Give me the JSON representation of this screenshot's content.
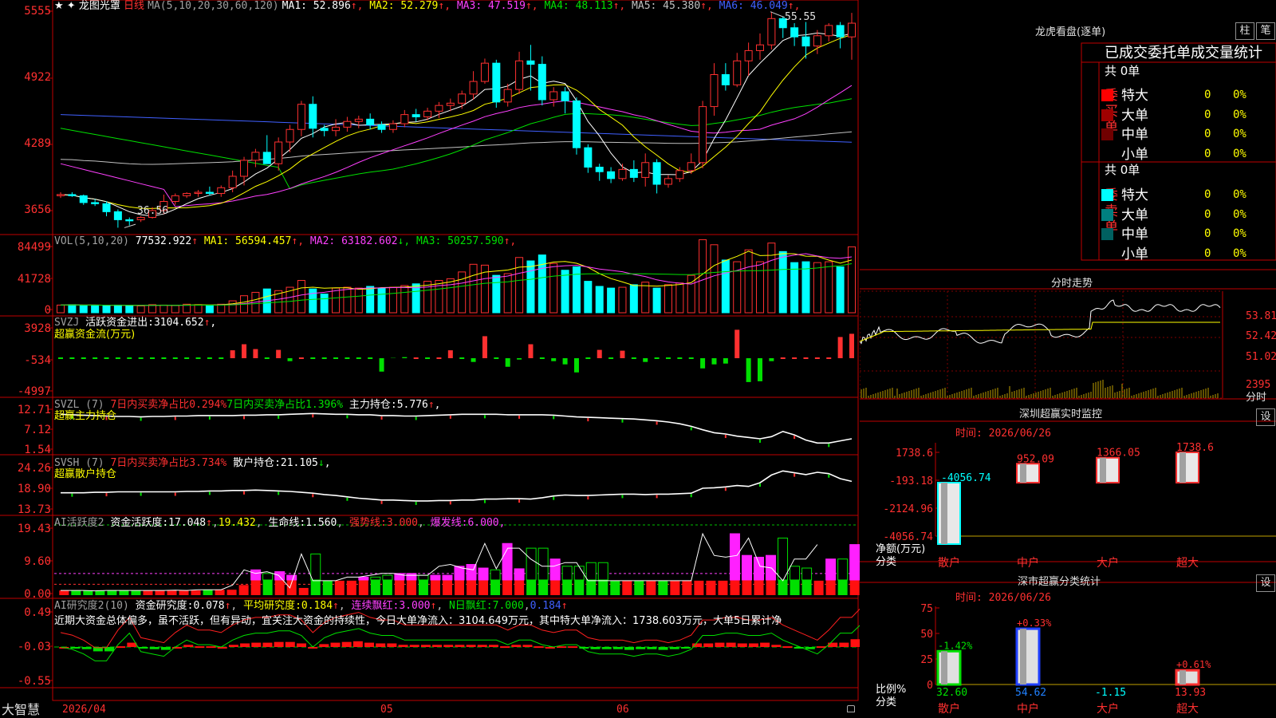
{
  "window": {
    "app_name": "大智慧",
    "date_label": "2026/04",
    "month_labels": [
      "05",
      "06"
    ],
    "star": "★",
    "diamond": "✦"
  },
  "main": {
    "stock": "龙图光罩",
    "period": "日线",
    "ma_title": "MA(5,10,20,30,60,120)",
    "ma": [
      {
        "label": "MA1:",
        "value": "52.896",
        "arrow": "↑",
        "color": "#ffffff"
      },
      {
        "label": "MA2:",
        "value": "52.279",
        "arrow": "↑",
        "color": "#ffff00"
      },
      {
        "label": "MA3:",
        "value": "47.519",
        "arrow": "↑",
        "color": "#ff40ff"
      },
      {
        "label": "MA4:",
        "value": "48.113",
        "arrow": "↑",
        "color": "#00e000"
      },
      {
        "label": "MA5:",
        "value": "45.380",
        "arrow": "↑",
        "color": "#c0c0c0"
      },
      {
        "label": "MA6:",
        "value": "46.049",
        "arrow": "↑",
        "color": "#4060ff"
      }
    ],
    "y_labels": [
      "5555",
      "4922",
      "4289",
      "3656"
    ],
    "high_label": "55.55",
    "low_label": "36.56"
  },
  "vol": {
    "title": "VOL(5,10,20)",
    "value": "77532.922",
    "arrow": "↑",
    "ma": [
      {
        "label": "MA1:",
        "value": "56594.457",
        "arrow": "↑",
        "color": "#ffff00"
      },
      {
        "label": "MA2:",
        "value": "63182.602",
        "arrow": "↓",
        "color": "#ff40ff"
      },
      {
        "label": "MA3:",
        "value": "50257.590",
        "arrow": "↑",
        "color": "#00e000"
      }
    ],
    "y_labels": [
      "84499",
      "41728",
      "0"
    ]
  },
  "svzj": {
    "title": "SVZJ",
    "label": "活跃资金进出:",
    "value": "3104.652",
    "arrow": "↑",
    "tail": ",",
    "subtitle": "超赢资金流(万元)",
    "y_labels": [
      "3928",
      "-534",
      "-4997"
    ]
  },
  "svzl": {
    "title": "SVZL (7)",
    "a": "7日内买卖净占比0.294%",
    "b": "7日内买卖净占比1.396%",
    "c_label": "主力持仓:",
    "c_value": "5.776",
    "arrow": "↑",
    "tail": ",",
    "subtitle": "超赢主力持仓",
    "y_labels": [
      "12.71",
      "7.12",
      "1.54"
    ]
  },
  "svsh": {
    "title": "SVSH (7)",
    "a": "7日内买卖净占比3.734%",
    "c_label": "散户持仓:",
    "c_value": "21.105",
    "arrow": "↓",
    "tail": ",",
    "subtitle": "超赢散户持仓",
    "y_labels": [
      "24.26",
      "18.90",
      "13.73"
    ]
  },
  "ai1": {
    "title": "AI活跃度2",
    "label": "资金活跃度:",
    "v1": "17.048",
    "a1": "↑",
    "v2": "19.432",
    "l2": "生命线:",
    "v3": "1.560",
    "l4": "强势线:",
    "v4": "3.000",
    "l5": "爆发线:",
    "v5": "6.000",
    "tail": ",",
    "y_labels": [
      "19.43",
      "9.60",
      "0.00"
    ]
  },
  "ai2": {
    "title": "AI研究度2(10)",
    "label": "资金研究度:",
    "v1": "0.078",
    "a1": "↑",
    "l2": "平均研究度:",
    "v2": "0.184",
    "a2": "↑",
    "l3": "连续飘红:",
    "v3": "3.000",
    "a3": "↑",
    "l4": "N日飘红:",
    "v4": "7.000",
    "v5": "0.184",
    "a5": "↑",
    "note": "近期大资金总体偏多，虽不活跃，但有异动，宜关注大资金的持续性，今日大单净流入：3104.649万元，其中特大单净流入：1738.603万元，大单5日累计净",
    "y_labels": [
      "0.49",
      "-0.03",
      "-0.55"
    ]
  },
  "right": {
    "lhb": {
      "title": "龙虎看盘(逐单)",
      "btn1": "柱",
      "btn2": "笔",
      "header": "已成交委托单成交量统计",
      "buy_side": "委买单",
      "sell_side": "委卖单",
      "total": "共 0单",
      "rows": [
        {
          "name": "特大",
          "count": "0",
          "pct": "0%",
          "buy_color": "#ff0000",
          "sell_color": "#00ffff"
        },
        {
          "name": "大单",
          "count": "0",
          "pct": "0%",
          "buy_color": "#a00000",
          "sell_color": "#008080"
        },
        {
          "name": "中单",
          "count": "0",
          "pct": "0%",
          "buy_color": "#700000",
          "sell_color": "#006060"
        },
        {
          "name": "小单",
          "count": "0",
          "pct": "0%",
          "buy_color": "",
          "sell_color": ""
        }
      ]
    },
    "fs": {
      "title": "分时走势",
      "y_labels": [
        "53.81",
        "52.42",
        "51.02",
        "2395"
      ],
      "unit": "分时"
    },
    "sz1": {
      "title": "深圳超赢实时监控",
      "btn": "设",
      "date": "时间: 2026/06/26",
      "y_labels": [
        "1738.6",
        "-193.18",
        "-2124.96",
        "-4056.74"
      ],
      "y_unit": "净额(万元)",
      "x_unit": "分类",
      "categories": [
        "散户",
        "中户",
        "大户",
        "超大"
      ],
      "values": [
        -4056.74,
        952.09,
        1366.05,
        1738.6
      ],
      "value_labels": [
        "-4056.74",
        "952.09",
        "1366.05",
        "1738.6"
      ]
    },
    "sz2": {
      "title": "深市超赢分类统计",
      "btn": "设",
      "date": "时间: 2026/06/26",
      "y_labels": [
        "75",
        "50",
        "25",
        "0"
      ],
      "y_unit": "比例%",
      "x_unit": "分类",
      "categories": [
        "散户",
        "中户",
        "大户",
        "超大"
      ],
      "values": [
        32.6,
        54.62,
        -1.15,
        13.93
      ],
      "deltas": [
        "-1.42%",
        "+0.33%",
        "",
        "+0.61%"
      ],
      "value_labels": [
        "32.60",
        "54.62",
        "-1.15",
        "13.93"
      ]
    }
  },
  "chart_data": [
    {
      "type": "candlestick",
      "title": "龙图光罩 日线",
      "ylim": [
        36.56,
        55.55
      ],
      "ohlc": [
        [
          39.4,
          39.7,
          39.2,
          39.5
        ],
        [
          39.5,
          39.7,
          39.3,
          39.4
        ],
        [
          39.4,
          39.5,
          38.6,
          38.8
        ],
        [
          38.8,
          39.1,
          38.5,
          38.7
        ],
        [
          38.7,
          38.9,
          37.6,
          38.0
        ],
        [
          38.0,
          38.2,
          36.6,
          37.3
        ],
        [
          37.3,
          37.5,
          36.8,
          37.2
        ],
        [
          37.3,
          37.6,
          37.1,
          37.5
        ],
        [
          37.5,
          38.4,
          37.4,
          38.1
        ],
        [
          38.1,
          39.5,
          37.8,
          38.9
        ],
        [
          38.9,
          39.6,
          38.6,
          39.4
        ],
        [
          39.4,
          39.7,
          39.2,
          39.6
        ],
        [
          39.6,
          39.9,
          39.3,
          39.7
        ],
        [
          39.7,
          40.2,
          39.4,
          39.6
        ],
        [
          39.6,
          40.3,
          39.3,
          40.1
        ],
        [
          40.1,
          41.6,
          39.7,
          41.1
        ],
        [
          41.1,
          42.8,
          40.3,
          42.5
        ],
        [
          42.5,
          43.5,
          41.9,
          43.2
        ],
        [
          43.2,
          44.7,
          42.4,
          42.2
        ],
        [
          42.2,
          44.5,
          41.6,
          44.1
        ],
        [
          44.1,
          45.6,
          43.2,
          45.2
        ],
        [
          45.2,
          47.7,
          44.6,
          47.4
        ],
        [
          47.4,
          48.1,
          44.5,
          45.3
        ],
        [
          45.3,
          45.6,
          44.6,
          45.1
        ],
        [
          45.1,
          46.1,
          44.6,
          45.4
        ],
        [
          45.4,
          46.3,
          45.0,
          45.9
        ],
        [
          45.9,
          46.4,
          45.3,
          46.1
        ],
        [
          46.1,
          46.6,
          45.2,
          45.6
        ],
        [
          45.6,
          45.9,
          44.9,
          45.2
        ],
        [
          45.2,
          46.0,
          44.9,
          45.7
        ],
        [
          45.7,
          46.9,
          45.4,
          46.5
        ],
        [
          46.5,
          47.0,
          45.9,
          46.3
        ],
        [
          46.3,
          47.1,
          46.0,
          46.8
        ],
        [
          46.8,
          47.6,
          46.2,
          47.3
        ],
        [
          47.3,
          47.9,
          46.8,
          47.5
        ],
        [
          47.5,
          48.6,
          47.0,
          48.3
        ],
        [
          48.3,
          50.3,
          47.8,
          49.4
        ],
        [
          49.4,
          51.4,
          49.2,
          51.0
        ],
        [
          51.0,
          51.3,
          47.1,
          47.6
        ],
        [
          47.6,
          49.2,
          47.2,
          48.7
        ],
        [
          48.7,
          52.0,
          48.3,
          51.2
        ],
        [
          51.2,
          52.6,
          48.6,
          50.9
        ],
        [
          50.9,
          51.6,
          47.3,
          47.8
        ],
        [
          47.8,
          48.9,
          47.2,
          48.5
        ],
        [
          48.5,
          48.9,
          46.6,
          47.7
        ],
        [
          47.7,
          48.0,
          43.0,
          43.6
        ],
        [
          43.6,
          43.9,
          41.4,
          41.9
        ],
        [
          41.9,
          42.2,
          40.7,
          41.5
        ],
        [
          41.5,
          41.9,
          40.5,
          40.9
        ],
        [
          40.9,
          42.2,
          40.7,
          41.7
        ],
        [
          41.7,
          42.5,
          40.6,
          41.0
        ],
        [
          41.0,
          43.1,
          40.2,
          42.3
        ],
        [
          42.3,
          42.6,
          39.6,
          40.4
        ],
        [
          40.4,
          41.2,
          40.1,
          40.9
        ],
        [
          40.9,
          41.9,
          40.6,
          41.6
        ],
        [
          41.6,
          43.1,
          41.3,
          42.3
        ],
        [
          42.3,
          47.7,
          41.8,
          47.2
        ],
        [
          47.2,
          51.0,
          46.4,
          50.0
        ],
        [
          50.0,
          51.0,
          48.6,
          49.1
        ],
        [
          49.1,
          51.9,
          48.9,
          51.2
        ],
        [
          51.2,
          52.8,
          49.9,
          52.1
        ],
        [
          52.1,
          53.6,
          51.3,
          52.6
        ],
        [
          52.6,
          55.5,
          52.2,
          54.9
        ],
        [
          54.9,
          55.1,
          53.2,
          54.1
        ],
        [
          54.1,
          54.5,
          52.5,
          53.3
        ],
        [
          53.3,
          54.6,
          51.4,
          52.5
        ],
        [
          52.5,
          53.9,
          51.8,
          53.4
        ],
        [
          53.4,
          54.5,
          52.9,
          54.3
        ],
        [
          54.3,
          54.6,
          52.3,
          53.3
        ],
        [
          53.3,
          55.4,
          51.3,
          54.5
        ]
      ]
    },
    {
      "type": "bar",
      "title": "VOL(5,10,20)",
      "ylim": [
        0,
        84499
      ],
      "values": [
        9000,
        9500,
        8500,
        9000,
        8000,
        9000,
        8500,
        8000,
        9500,
        9000,
        8500,
        10000,
        9500,
        9000,
        10000,
        14000,
        20000,
        24000,
        28000,
        26000,
        30000,
        38000,
        28000,
        22000,
        29000,
        30000,
        29000,
        31000,
        29000,
        30000,
        32000,
        34000,
        37000,
        38000,
        40000,
        48000,
        57000,
        56000,
        44000,
        46000,
        65000,
        61000,
        68000,
        58000,
        50000,
        54000,
        37000,
        31000,
        29000,
        30000,
        33000,
        36000,
        29000,
        33000,
        35000,
        44000,
        86000,
        80000,
        62000,
        60000,
        74000,
        60000,
        82000,
        72000,
        59000,
        60000,
        59000,
        60000,
        54000,
        77533
      ]
    },
    {
      "type": "bar",
      "title": "SVZJ 活跃资金进出",
      "ylim": [
        -4997,
        3928
      ],
      "values": [
        -200,
        -150,
        -300,
        -200,
        -250,
        -180,
        -200,
        -150,
        -250,
        -200,
        -180,
        -150,
        -200,
        -250,
        -300,
        450,
        1200,
        600,
        -100,
        500,
        -900,
        100,
        -300,
        -100,
        -200,
        -100,
        -200,
        -100,
        -2200,
        -500,
        -400,
        300,
        -150,
        200,
        450,
        -200,
        -1000,
        2200,
        -100,
        -1600,
        -700,
        1200,
        -100,
        -900,
        -1300,
        -2300,
        -100,
        500,
        -100,
        400,
        -300,
        -1000,
        -150,
        -200,
        -100,
        -120,
        -1800,
        -1300,
        -1200,
        3000,
        -3500,
        -3400,
        -900,
        0,
        0,
        0,
        0,
        0,
        2100,
        2500,
        3105
      ]
    },
    {
      "type": "line",
      "title": "SVZL 主力持仓",
      "ylim": [
        1.54,
        12.71
      ],
      "values": [
        10.6,
        10.5,
        10.4,
        10.3,
        10.2,
        10.1,
        10.1,
        10.0,
        10.1,
        10.1,
        10.2,
        10.2,
        10.3,
        10.3,
        10.3,
        10.3,
        10.4,
        10.4,
        10.5,
        10.5,
        10.6,
        10.7,
        10.8,
        10.7,
        10.6,
        10.6,
        10.5,
        10.5,
        10.3,
        10.3,
        10.2,
        10.2,
        10.3,
        10.4,
        10.5,
        10.6,
        10.6,
        10.6,
        10.6,
        10.5,
        10.5,
        10.5,
        10.5,
        10.4,
        10.2,
        10.0,
        9.9,
        9.8,
        9.7,
        9.6,
        9.5,
        9.3,
        9.1,
        8.8,
        8.4,
        7.8,
        7.0,
        6.3,
        6.0,
        5.5,
        5.2,
        4.9,
        5.4,
        6.6,
        5.8,
        4.6,
        3.9,
        3.9,
        4.4,
        4.9,
        5.776
      ]
    },
    {
      "type": "line",
      "title": "SVSH 散户持仓",
      "ylim": [
        13.73,
        24.26
      ],
      "values": [
        18.0,
        18.0,
        18.0,
        18.1,
        18.1,
        18.2,
        18.2,
        18.2,
        18.2,
        18.2,
        18.2,
        18.3,
        18.3,
        18.4,
        18.4,
        18.5,
        18.5,
        18.6,
        18.5,
        18.4,
        18.3,
        18.1,
        17.9,
        17.6,
        17.4,
        17.1,
        16.8,
        16.6,
        16.4,
        16.4,
        16.3,
        16.2,
        16.2,
        16.3,
        16.3,
        16.4,
        16.4,
        16.6,
        16.6,
        16.7,
        16.7,
        16.6,
        16.9,
        17.3,
        17.5,
        17.4,
        17.4,
        17.5,
        17.6,
        17.7,
        17.7,
        17.6,
        17.7,
        17.7,
        17.8,
        17.9,
        19.0,
        19.1,
        19.3,
        19.6,
        19.4,
        20.2,
        21.9,
        22.8,
        22.4,
        22.0,
        22.5,
        22.2,
        21.1,
        20.5,
        21.105
      ]
    },
    {
      "type": "bar",
      "title": "AI活跃度2 资金活跃度",
      "ylim": [
        0,
        19.43
      ],
      "values": [
        1.3,
        1.3,
        1.3,
        1.2,
        1.3,
        1.3,
        1.3,
        1.3,
        1.3,
        1.3,
        1.4,
        1.3,
        1.5,
        1.5,
        1.5,
        2.8,
        7.0,
        6.0,
        6.5,
        5.5,
        2.0,
        11.4,
        4.0,
        4.0,
        4.0,
        5.0,
        5.0,
        5.5,
        6.0,
        6.0,
        5.5,
        5.5,
        5.5,
        8.0,
        8.5,
        7.5,
        7.0,
        14.3,
        7.3,
        13.0,
        13.0,
        10.0,
        8.0,
        8.0,
        9.0,
        9.0,
        4.0,
        4.0,
        4.0,
        4.0,
        4.0,
        4.0,
        4.0,
        4.0,
        4.0,
        4.0,
        17.0,
        11.0,
        10.5,
        11.0,
        15.8,
        8.0,
        7.5,
        4.0,
        10.0,
        10.0,
        14.0
      ]
    },
    {
      "type": "bar",
      "title": "AI研究度2(10) 资金研究度",
      "ylim": [
        -0.55,
        0.49
      ],
      "values": [
        -0.03,
        -0.04,
        -0.06,
        -0.09,
        -0.09,
        -0.02,
        0.03,
        -0.05,
        -0.06,
        -0.07,
        -0.03,
        0.0,
        -0.02,
        -0.02,
        -0.03,
        0.0,
        0.02,
        0.03,
        0.03,
        0.04,
        0.04,
        0.02,
        -0.03,
        0.01,
        0.03,
        0.04,
        0.05,
        0.03,
        0.02,
        0.02,
        0.0,
        0.0,
        0.0,
        0.0,
        0.0,
        0.0,
        0.0,
        0.0,
        0.0,
        -0.02,
        0.0,
        0.0,
        -0.02,
        -0.03,
        -0.02,
        -0.02,
        -0.05,
        -0.06,
        -0.06,
        -0.06,
        -0.07,
        -0.06,
        -0.06,
        -0.07,
        -0.06,
        -0.04,
        0.02,
        0.02,
        0.03,
        0.03,
        0.02,
        0.02,
        0.03,
        0.0,
        -0.02,
        -0.04,
        -0.06,
        -0.02,
        0.03,
        0.03,
        0.078
      ]
    }
  ]
}
